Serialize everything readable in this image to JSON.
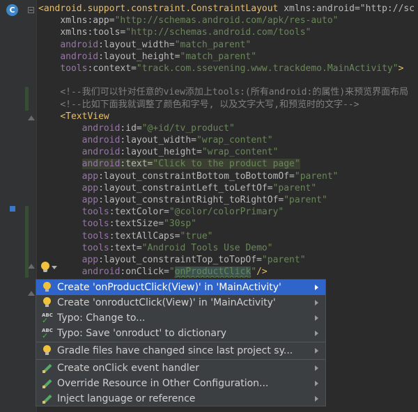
{
  "editor": {
    "header_tag": "android.support.constraint.ConstraintLayout",
    "header_xmlns_android": "xmlns:android=\"http://sc",
    "app_ns_attr": "xmlns:app=",
    "app_ns_val": "\"http://schemas.android.com/apk/res-auto\"",
    "tools_ns_attr": "xmlns:tools=",
    "tools_ns_val": "\"http://schemas.android.com/tools\"",
    "lw_ns": "android",
    "lw_attr": ":layout_width=",
    "lw_val": "\"match_parent\"",
    "lh_ns": "android",
    "lh_attr": ":layout_height=",
    "lh_val": "\"match_parent\"",
    "ctx_ns": "tools",
    "ctx_attr": ":context=",
    "ctx_val": "\"track.com.ssevening.www.trackdemo.MainActivity\"",
    "ctx_close": ">",
    "comment1": "<!--我们可以针对任意的view添加上tools:(所有android:的属性)来预览界面布局",
    "comment2": "<!--比如下面我就调整了颜色和字号, 以及文字大写,和预览时的文字-->",
    "textview_tag": "<TextView",
    "id_ns": "android",
    "id_attr": ":id=",
    "id_val": "\"@+id/tv_product\"",
    "tw_ns": "android",
    "tw_attr": ":layout_width=",
    "tw_val": "\"wrap_content\"",
    "th_ns": "android",
    "th_attr": ":layout_height=",
    "th_val": "\"wrap_content\"",
    "text_ns": "android",
    "text_attr": ":text=",
    "text_val": "\"Click to the product page\"",
    "cb_ns": "app",
    "cb_attr": ":layout_constraintBottom_toBottomOf=",
    "cb_val": "\"parent\"",
    "cl_ns": "app",
    "cl_attr": ":layout_constraintLeft_toLeftOf=",
    "cl_val": "\"parent\"",
    "cr_ns": "app",
    "cr_attr": ":layout_constraintRight_toRightOf=",
    "cr_val": "\"parent\"",
    "tc_ns": "tools",
    "tc_attr": ":textColor=",
    "tc_val": "\"@color/colorPrimary\"",
    "ts_ns": "tools",
    "ts_attr": ":textSize=",
    "ts_val": "\"30sp\"",
    "tac_ns": "tools",
    "tac_attr": ":textAllCaps=",
    "tac_val": "\"true\"",
    "tt_ns": "tools",
    "tt_attr": ":text=",
    "tt_val": "\"Android Tools Use Demo\"",
    "ct_ns": "app",
    "ct_attr": ":layout_constraintTop_toTopOf=",
    "ct_val": "\"parent\"",
    "oc_ns": "android",
    "oc_attr": ":onClick=",
    "oc_q1": "\"",
    "oc_val": "onProductClick",
    "oc_q2": "\"",
    "oc_close": "/>"
  },
  "popup": {
    "items": [
      {
        "label": "Create 'onProductClick(View)' in 'MainActivity'",
        "icon": "lightbulb-icon"
      },
      {
        "label": "Create 'onroductClick(View)' in 'MainActivity'",
        "icon": "lightbulb-icon"
      },
      {
        "label": "Typo: Change to...",
        "icon": "spellcheck-icon"
      },
      {
        "label": "Typo: Save 'onroduct' to dictionary",
        "icon": "spellcheck-icon"
      },
      {
        "label": "Gradle files have changed since last project sy...",
        "icon": "lightbulb-icon"
      },
      {
        "label": "Create onClick event handler",
        "icon": "pencil-icon"
      },
      {
        "label": "Override Resource in Other Configuration...",
        "icon": "pencil-icon"
      },
      {
        "label": "Inject language or reference",
        "icon": "pencil-icon"
      }
    ],
    "abc_text": "ABC"
  },
  "gutter": {
    "class_icon_letter": "C"
  },
  "colors": {
    "selection": "#2f65ca",
    "editor_bg": "#2b2b2b",
    "tag": "#e8bf6a",
    "value": "#6a8759",
    "namespace": "#9876aa"
  }
}
